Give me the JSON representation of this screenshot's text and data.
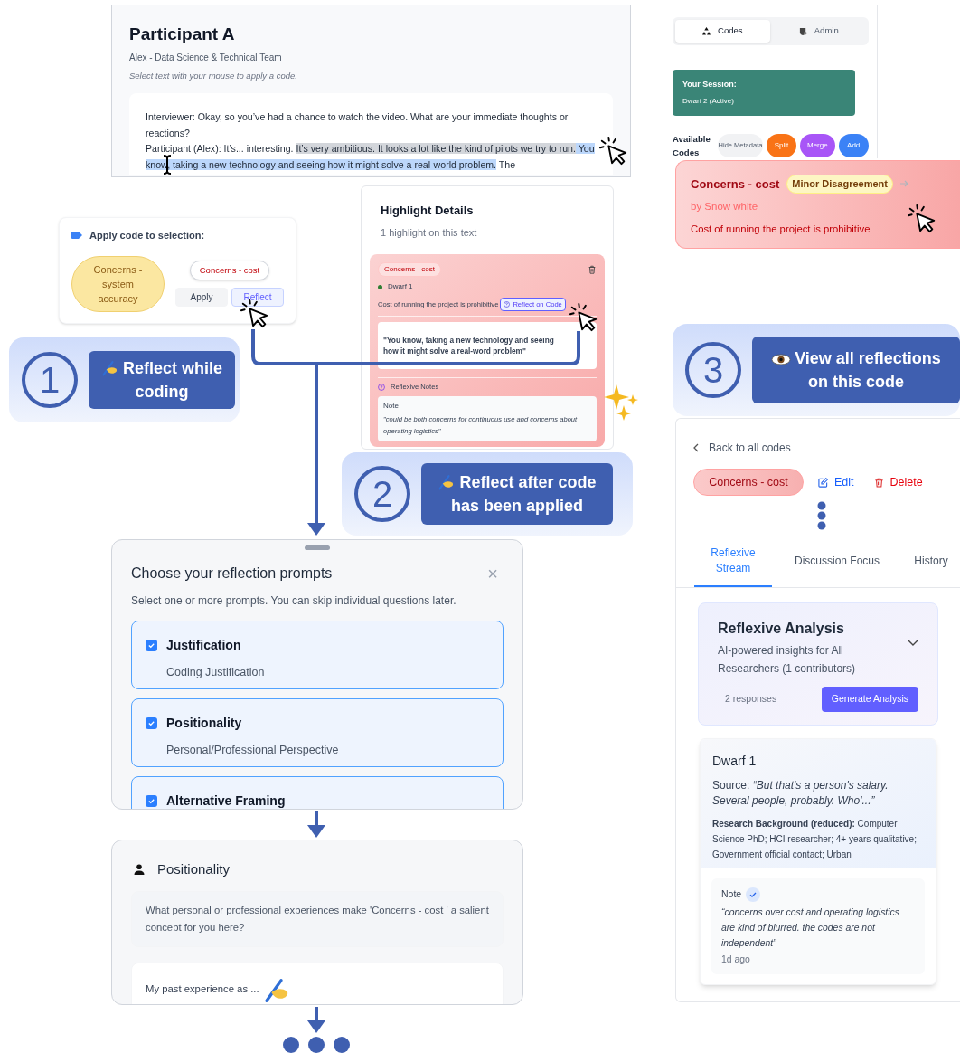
{
  "transcript_panel": {
    "title": "Participant A",
    "subtitle": "Alex - Data Science & Technical Team",
    "hint": "Select text with your mouse to apply a code.",
    "paragraphs": [
      {
        "segments": [
          {
            "text": "Interviewer: Okay, so you’ve had a chance to watch the video. What are your immediate thoughts or reactions?"
          }
        ]
      },
      {
        "segments": [
          {
            "text": "Participant (Alex): It’s... interesting. "
          },
          {
            "text": "It’s very ambitious. It looks a lot like the kind of pilots we try to run.",
            "color": "#d3d6db"
          },
          {
            "text": " You know, taking a new technology and seeing how it might solve a real-world problem.",
            "color": "#bcd7fb"
          },
          {
            "text": " The"
          }
        ]
      }
    ]
  },
  "apply_popup": {
    "title": "Apply code to selection:",
    "suggested_code": "Concerns - system accuracy",
    "code_chip": "Concerns - cost",
    "buttons": [
      {
        "label": "Apply",
        "selected": false
      },
      {
        "label": "Reflect",
        "selected": true
      }
    ]
  },
  "steps": [
    {
      "number": "1",
      "label": "Reflect while coding"
    },
    {
      "number": "2",
      "label": "Reflect after code has been applied"
    },
    {
      "number": "3",
      "label": "View all reflections on this code"
    }
  ],
  "highlight_details": {
    "title": "Highlight Details",
    "subtitle": "1 highlight on this text",
    "code_tag": "Concerns - cost",
    "coder": {
      "name": "Dwarf 1",
      "color": "#2f7d32"
    },
    "description": "Cost of running the project is prohibitive",
    "reflect_button": "Reflect on Code",
    "quote": "\"You know, taking a new technology and seeing how it might solve a real-word problem\"",
    "notes_title": "Reflexive Notes",
    "note": {
      "label": "Note",
      "text": "\"could be both concerns for continuous use and concerns about operating logistics\""
    }
  },
  "prompt_picker": {
    "title": "Choose your reflection prompts",
    "close": "×",
    "subtitle": "Select one or more prompts. You can skip individual questions later.",
    "options": [
      {
        "title": "Justification",
        "description": "Coding Justification",
        "checked": true
      },
      {
        "title": "Positionality",
        "description": "Personal/Professional Perspective",
        "checked": true
      },
      {
        "title": "Alternative Framing",
        "checked": true
      }
    ]
  },
  "prompt_card": {
    "title": "Positionality",
    "question": "What personal or professional experiences make 'Concerns - cost ' a salient concept for you here?",
    "answer": "My past experience as ..."
  },
  "sidebar": {
    "tabs": [
      {
        "label": "Codes",
        "selected": true
      },
      {
        "label": "Admin",
        "selected": false
      }
    ],
    "session": {
      "title": "Your Session:",
      "value": "Dwarf 2 (Active)"
    },
    "available_label": "Available Codes",
    "actions": [
      {
        "label": "Hide Metadata",
        "color": "#f1f2f4"
      },
      {
        "label": "Split",
        "color": "#f97316"
      },
      {
        "label": "Merge",
        "color": "#a855f7"
      },
      {
        "label": "Add",
        "color": "#3b82f6"
      }
    ]
  },
  "code_card": {
    "title": "Concerns - cost",
    "badge": "Minor Disagreement",
    "author": "by Snow white",
    "description": "Cost of running the project is prohibitive"
  },
  "code_detail": {
    "back": "Back to all codes",
    "code": "Concerns - cost",
    "edit": "Edit",
    "delete": "Delete",
    "tabs": [
      {
        "label": "Reflexive Stream",
        "selected": true
      },
      {
        "label": "Discussion Focus",
        "selected": false
      },
      {
        "label": "History",
        "selected": false
      }
    ],
    "analysis": {
      "title": "Reflexive Analysis",
      "subtitle": "AI-powered insights for All Researchers (1 contributors)",
      "responses": "2 responses",
      "button": "Generate Analysis"
    },
    "reflection": {
      "author": "Dwarf 1",
      "source": "Source: *“But that's a person's salary. Several people, probably. Who'...”*",
      "background": "**Research Background (reduced):** Computer Science PhD; HCI researcher; 4+ years qualitative; Government official contact; Urban",
      "note": {
        "label": "Note",
        "text": "“concerns over cost and operating logistics are kind of blurred. the codes are not independent”",
        "time": "1d ago"
      }
    }
  }
}
